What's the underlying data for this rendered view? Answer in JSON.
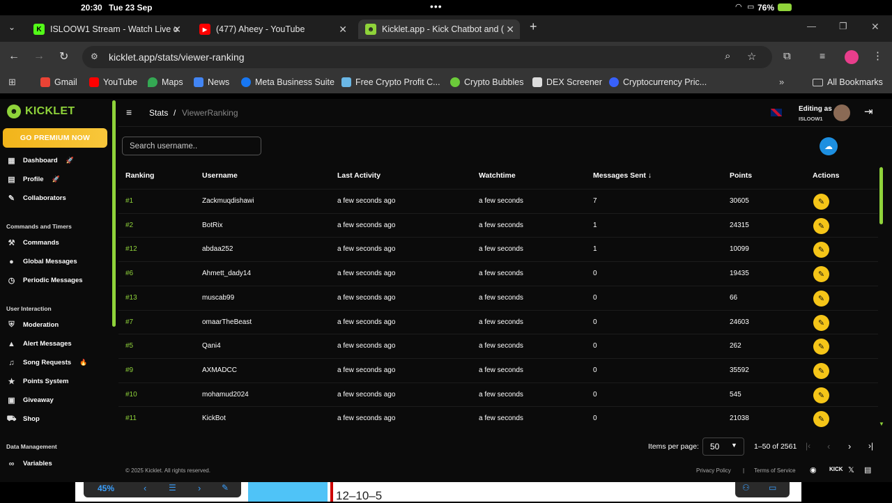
{
  "status_bar": {
    "time": "20:30",
    "date": "Tue 23 Sep",
    "battery": "76%"
  },
  "tabs": [
    {
      "title": "ISLOOW1 Stream - Watch Live o",
      "favicon": "K"
    },
    {
      "title": "(477) Aheey - YouTube",
      "favicon": "▶"
    },
    {
      "title": "Kicklet.app - Kick Chatbot and (",
      "favicon": "☻"
    }
  ],
  "address": {
    "url": "kicklet.app/stats/viewer-ranking"
  },
  "bookmarks": [
    {
      "label": "Gmail",
      "color": "#ea4335"
    },
    {
      "label": "YouTube",
      "color": "#ff0000"
    },
    {
      "label": "Maps",
      "color": "#34a853"
    },
    {
      "label": "News",
      "color": "#4285f4"
    },
    {
      "label": "Meta Business Suite",
      "color": "#1877f2"
    },
    {
      "label": "Free Crypto Profit C...",
      "color": "#6ab7e6"
    },
    {
      "label": "Crypto Bubbles",
      "color": "#6ccb3a"
    },
    {
      "label": "DEX Screener",
      "color": "#dddddd"
    },
    {
      "label": "Cryptocurrency Pric...",
      "color": "#3861fb"
    }
  ],
  "all_bookmarks": "All Bookmarks",
  "sidebar": {
    "logo": "KICKLET",
    "premium": "GO PREMIUM NOW",
    "items_top": [
      {
        "label": "Dashboard",
        "emoji": "🚀",
        "icon": "dashboard-icon"
      },
      {
        "label": "Profile",
        "emoji": "🚀",
        "icon": "profile-icon"
      },
      {
        "label": "Collaborators",
        "emoji": "",
        "icon": "collaborators-icon"
      }
    ],
    "section_commands": "Commands and Timers",
    "items_commands": [
      {
        "label": "Commands",
        "icon": "wrench-icon"
      },
      {
        "label": "Global Messages",
        "icon": "chat-icon"
      },
      {
        "label": "Periodic Messages",
        "icon": "clock-icon"
      }
    ],
    "section_user": "User Interaction",
    "items_user": [
      {
        "label": "Moderation",
        "emoji": "",
        "icon": "shield-icon"
      },
      {
        "label": "Alert Messages",
        "emoji": "",
        "icon": "alert-icon"
      },
      {
        "label": "Song Requests",
        "emoji": "🔥",
        "icon": "music-icon"
      },
      {
        "label": "Points System",
        "emoji": "",
        "icon": "star-icon"
      },
      {
        "label": "Giveaway",
        "emoji": "",
        "icon": "gift-icon"
      },
      {
        "label": "Shop",
        "emoji": "",
        "icon": "cart-icon"
      }
    ],
    "section_data": "Data Management",
    "items_data": [
      {
        "label": "Variables",
        "icon": "link-icon"
      }
    ]
  },
  "topbar": {
    "crumb_root": "Stats",
    "crumb_sep": "/",
    "crumb_current": "ViewerRanking",
    "editing_as": "Editing as",
    "username": "ISLOOW1"
  },
  "search": {
    "placeholder": "Search username.."
  },
  "table": {
    "headers": [
      "Ranking",
      "Username",
      "Last Activity",
      "Watchtime",
      "Messages Sent ↓",
      "Points",
      "Actions"
    ],
    "rows": [
      [
        "#1",
        "Zackmuqdishawi",
        "a few seconds ago",
        "a few seconds",
        "7",
        "30605"
      ],
      [
        "#2",
        "BotRix",
        "a few seconds ago",
        "a few seconds",
        "1",
        "24315"
      ],
      [
        "#12",
        "abdaa252",
        "a few seconds ago",
        "a few seconds",
        "1",
        "10099"
      ],
      [
        "#6",
        "Ahmett_dady14",
        "a few seconds ago",
        "a few seconds",
        "0",
        "19435"
      ],
      [
        "#13",
        "muscab99",
        "a few seconds ago",
        "a few seconds",
        "0",
        "66"
      ],
      [
        "#7",
        "omaarTheBeast",
        "a few seconds ago",
        "a few seconds",
        "0",
        "24603"
      ],
      [
        "#5",
        "Qani4",
        "a few seconds ago",
        "a few seconds",
        "0",
        "262"
      ],
      [
        "#9",
        "AXMADCC",
        "a few seconds ago",
        "a few seconds",
        "0",
        "35592"
      ],
      [
        "#10",
        "mohamud2024",
        "a few seconds ago",
        "a few seconds",
        "0",
        "545"
      ],
      [
        "#11",
        "KickBot",
        "a few seconds ago",
        "a few seconds",
        "0",
        "21038"
      ]
    ]
  },
  "pager": {
    "label": "Items per page:",
    "value": "50",
    "range": "1–50 of 2561"
  },
  "footer": {
    "copyright": "© 2025 Kicklet. All rights reserved.",
    "privacy": "Privacy Policy",
    "sep": "|",
    "terms": "Terms of Service"
  },
  "dock": {
    "zoom": "45%",
    "partial_text": "12–10–5"
  },
  "colors": {
    "accent": "#8fd33a",
    "premium": "#f5b81c",
    "edit": "#f5c518",
    "cloud": "#1d8fe0"
  }
}
